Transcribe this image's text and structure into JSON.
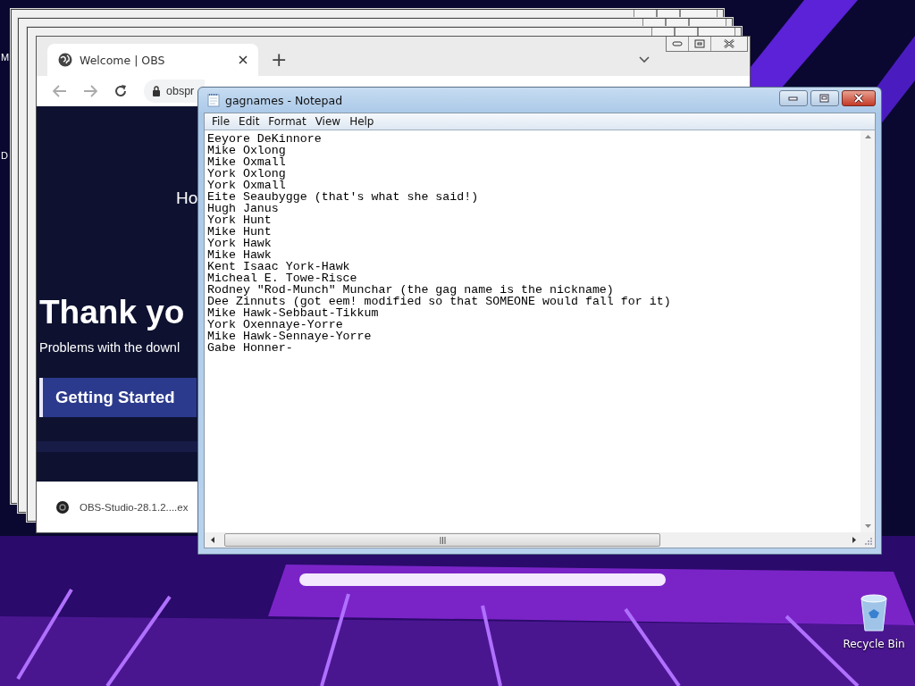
{
  "desktop": {
    "icons": [
      {
        "kind": "cut",
        "label": "M"
      },
      {
        "kind": "cut",
        "label": "D"
      },
      {
        "kind": "recycle",
        "label": "Recycle Bin"
      }
    ]
  },
  "browser": {
    "tab_title": "Welcome | OBS",
    "new_tab": "+",
    "address": "obspr",
    "page": {
      "nav_text": "Ho",
      "heading": "Thank yo",
      "subtitle": "Problems with the downl",
      "button": "Getting Started"
    },
    "download": {
      "file": "OBS-Studio-28.1.2....ex"
    }
  },
  "notepad": {
    "title": "gagnames - Notepad",
    "menu": [
      "File",
      "Edit",
      "Format",
      "View",
      "Help"
    ],
    "lines": [
      "Eeyore DeKinnore",
      "Mike Oxlong",
      "Mike Oxmall",
      "York Oxlong",
      "York Oxmall",
      "Eite Seaubygge (that's what she said!)",
      "Hugh Janus",
      "York Hunt",
      "Mike Hunt",
      "York Hawk",
      "Mike Hawk",
      "Kent Isaac York-Hawk",
      "Micheal E. Towe-Risce",
      "Rodney \"Rod-Munch\" Munchar (the gag name is the nickname)",
      "Dee Zinnuts (got eem! modified so that SOMEONE would fall for it)",
      "Mike Hawk-Sebbaut-Tikkum",
      "York Oxennaye-Yorre",
      "Mike Hawk-Sennaye-Yorre",
      "Gabe Honner-"
    ]
  }
}
